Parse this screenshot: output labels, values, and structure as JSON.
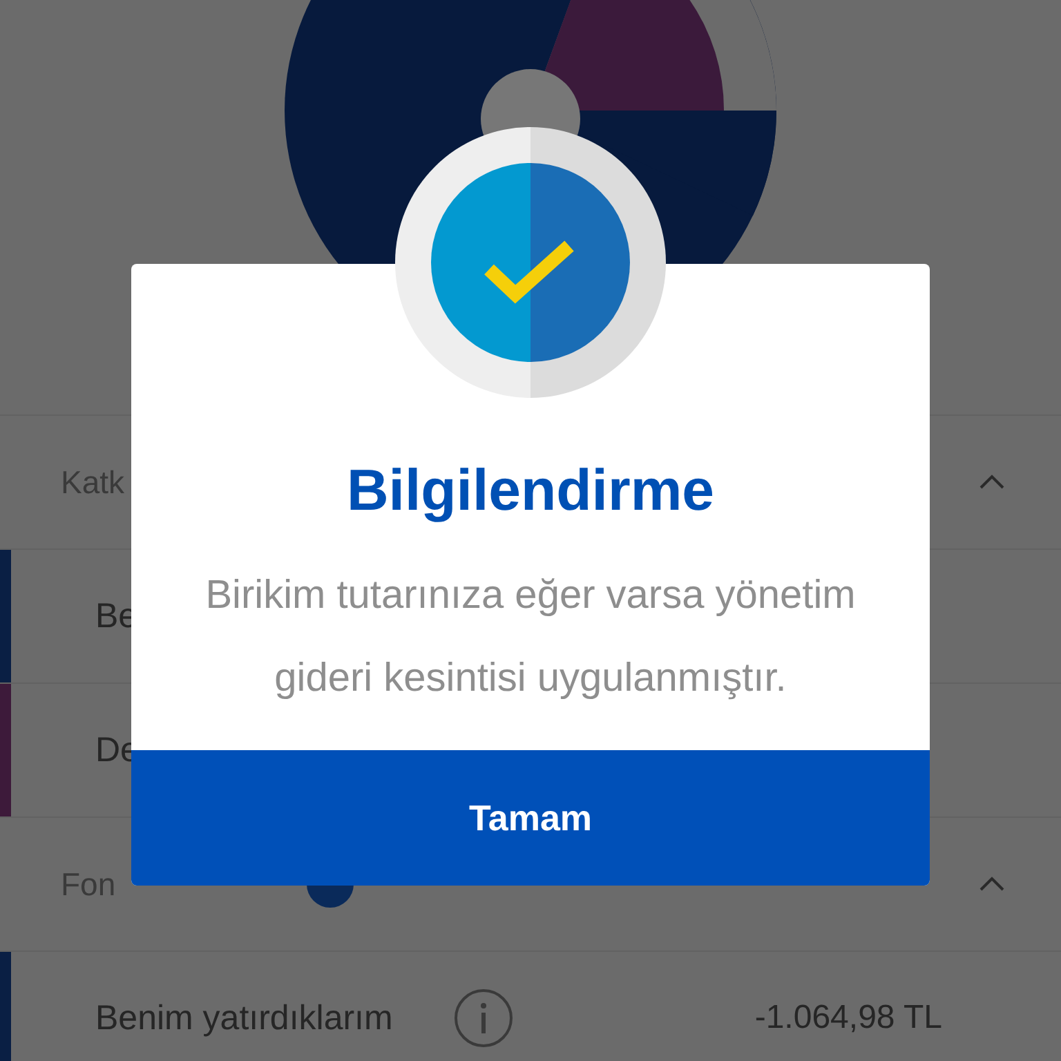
{
  "page": {
    "sections": [
      {
        "kind": "header",
        "label": "Katk"
      },
      {
        "kind": "item",
        "label": "Be",
        "color": "#0a1f44"
      },
      {
        "kind": "item",
        "label": "De",
        "color": "#3d1a3a"
      },
      {
        "kind": "header_info",
        "label": "Fon"
      },
      {
        "kind": "item_value",
        "label": "Benim yatırdıklarım",
        "value": "-1.064,98 TL",
        "color": "#0a1f44"
      }
    ]
  },
  "dialog": {
    "title": "Bilgilendirme",
    "message": "Birikim tutarınıza eğer varsa yönetim gideri kesintisi uygulanmıştır.",
    "button": "Tamam"
  }
}
